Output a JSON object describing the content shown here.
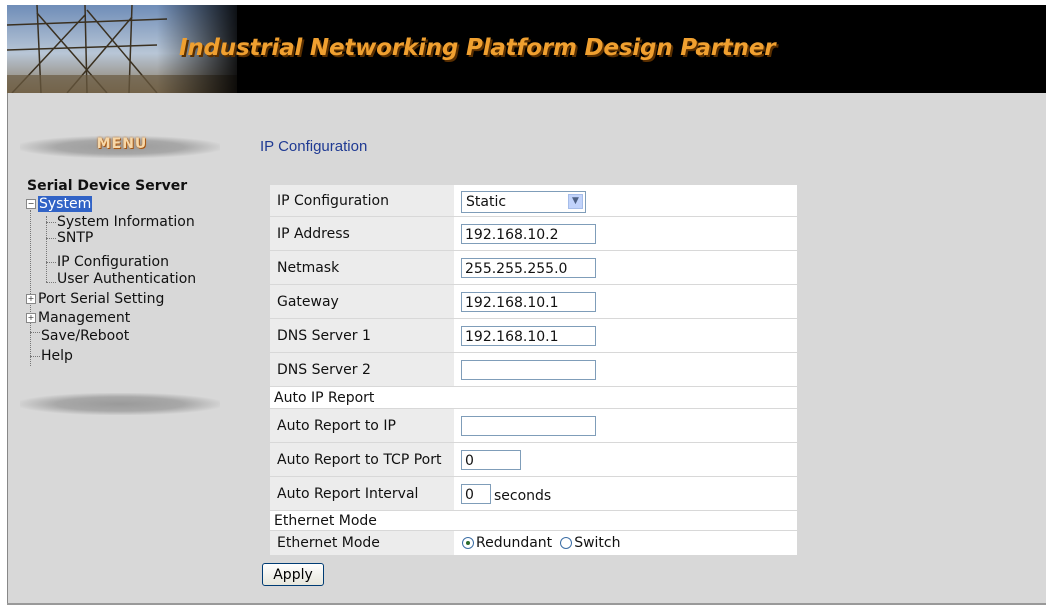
{
  "banner": {
    "title": "Industrial  Networking Platform Design Partner"
  },
  "menu": {
    "label": "MENU",
    "root": "Serial Device Server",
    "items": [
      {
        "label": "System",
        "expander": "−"
      },
      {
        "label": "System Information"
      },
      {
        "label": "SNTP"
      },
      {
        "label": "IP Configuration"
      },
      {
        "label": "User Authentication"
      },
      {
        "label": "Port Serial Setting",
        "expander": "+"
      },
      {
        "label": "Management",
        "expander": "+"
      },
      {
        "label": "Save/Reboot"
      },
      {
        "label": "Help"
      }
    ]
  },
  "page": {
    "title": "IP Configuration"
  },
  "form": {
    "ip_config": {
      "label": "IP Configuration",
      "value": "Static"
    },
    "ip_address": {
      "label": "IP Address",
      "value": "192.168.10.2"
    },
    "netmask": {
      "label": "Netmask",
      "value": "255.255.255.0"
    },
    "gateway": {
      "label": "Gateway",
      "value": "192.168.10.1"
    },
    "dns1": {
      "label": "DNS Server 1",
      "value": "192.168.10.1"
    },
    "dns2": {
      "label": "DNS Server 2",
      "value": ""
    },
    "auto_ip_section": "Auto IP Report",
    "auto_report_ip": {
      "label": "Auto Report to IP",
      "value": ""
    },
    "auto_report_port": {
      "label": "Auto Report to TCP Port",
      "value": "0"
    },
    "auto_report_interval": {
      "label": "Auto Report Interval",
      "value": "0",
      "unit": "seconds"
    },
    "ethernet_section": "Ethernet Mode",
    "ethernet_mode": {
      "label": "Ethernet Mode",
      "option_redundant": "Redundant",
      "option_switch": "Switch",
      "selected": "Redundant"
    }
  },
  "apply_label": "Apply",
  "colors": {
    "banner_bg": "#000000",
    "banner_title": "#f0a030",
    "content_bg": "#d8d8d8",
    "selected_item": "#3163c6",
    "page_title": "#1f3a93"
  }
}
